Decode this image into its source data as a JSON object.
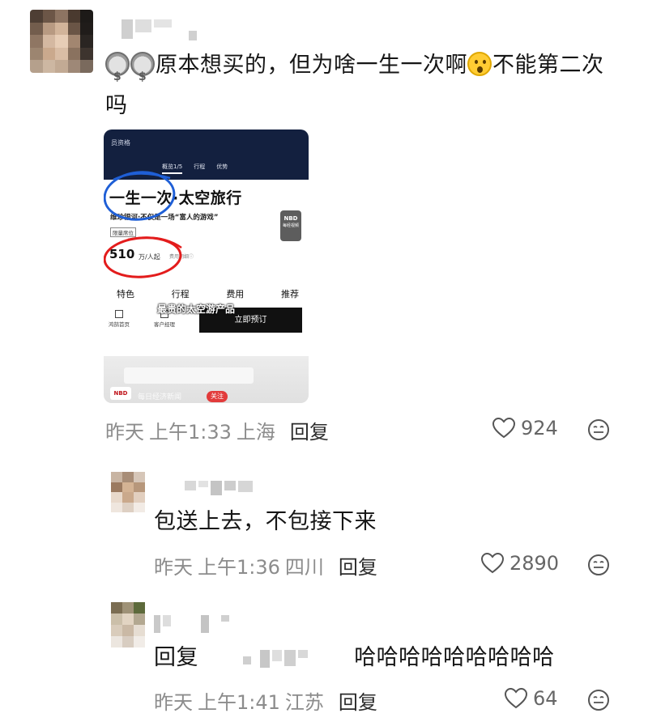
{
  "comments": [
    {
      "text_before_emoji": "原本想买的，但为啥一生一次啊",
      "text_after_emoji": "不能第二次吗",
      "emojis": [
        "money-bag-icon",
        "money-bag-icon",
        "astonished-face-icon"
      ],
      "date": "昨天",
      "time": "上午1:33",
      "location": "上海",
      "reply_label": "回复",
      "likes": "924"
    },
    {
      "text": "包送上去，不包接下来",
      "date": "昨天",
      "time": "上午1:36",
      "location": "四川",
      "reply_label": "回复",
      "likes": "2890"
    },
    {
      "reply_prefix": "回复",
      "text": "哈哈哈哈哈哈哈哈哈",
      "date": "昨天",
      "time": "上午1:41",
      "location": "江苏",
      "reply_label": "回复",
      "likes": "64"
    }
  ],
  "embedded_screenshot": {
    "header_title": "员资格",
    "tabs": [
      "概览1/5",
      "行程",
      "优势"
    ],
    "headline": "一生一次·太空旅行",
    "subtitle": "维珍银河·不仅是一场“富人的游戏”",
    "tag": "限量席位",
    "price": "510",
    "price_unit": "万/人起",
    "price_note": "费用明细ⓘ",
    "watermark": "NBD",
    "watermark_sub": "每经视频",
    "nav": [
      "特色",
      "行程",
      "费用",
      "推荐"
    ],
    "caption": "最贵的太空游产品",
    "bottom_icons": [
      "鸿鹄首页",
      "客户经理"
    ],
    "book_button": "立即预订",
    "source_logo": "NBD",
    "source_name": "每日经济新闻",
    "follow_button": "关注"
  },
  "colors": {
    "annotation_blue": "#1f5fd6",
    "annotation_red": "#e31c1c",
    "follow_red": "#e23b3b",
    "header_navy": "#13203f",
    "meta_gray": "#8c8c8c"
  }
}
